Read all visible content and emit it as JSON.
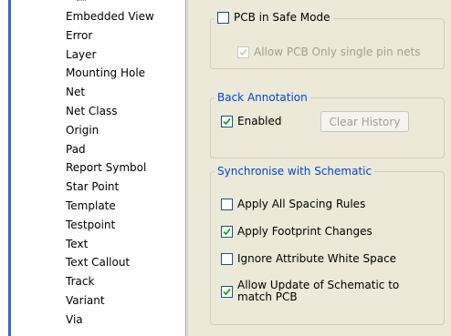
{
  "tree": {
    "items": [
      "Embedded View",
      "Error",
      "Layer",
      "Mounting Hole",
      "Net",
      "Net Class",
      "Origin",
      "Pad",
      "Report Symbol",
      "Star Point",
      "Template",
      "Testpoint",
      "Text",
      "Text Callout",
      "Track",
      "Variant",
      "Via"
    ]
  },
  "safe_mode": {
    "label": "PCB in Safe Mode",
    "checked": false,
    "allow_single_pin": {
      "label": "Allow PCB Only single pin nets",
      "checked": true,
      "disabled": true
    }
  },
  "back_annotation": {
    "legend": "Back Annotation",
    "enabled_label": "Enabled",
    "enabled_checked": true,
    "clear_history_label": "Clear History"
  },
  "sync": {
    "legend": "Synchronise with Schematic",
    "options": [
      {
        "label": "Apply All Spacing Rules",
        "checked": false
      },
      {
        "label": "Apply Footprint Changes",
        "checked": true
      },
      {
        "label": "Ignore Attribute White Space",
        "checked": false
      },
      {
        "label": "Allow Update of Schematic to match PCB",
        "checked": true
      }
    ]
  },
  "colors": {
    "legend_blue": "#0046d5",
    "checkmark_green": "#21a121",
    "checkmark_disabled": "#cac8bb",
    "selection_bar": "#3d64c8"
  }
}
